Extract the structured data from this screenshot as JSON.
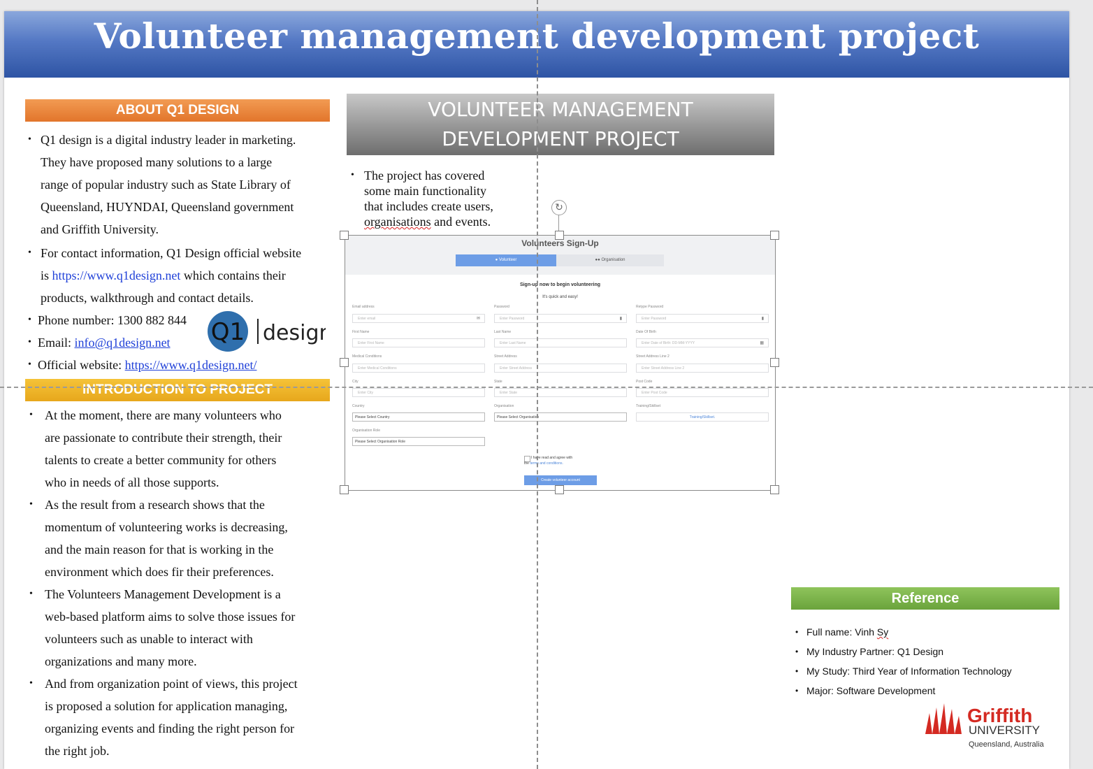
{
  "poster": {
    "title": "Volunteer management development project"
  },
  "about": {
    "heading": "ABOUT Q1 DESIGN",
    "p1_lines": [
      "Q1 design is a digital industry leader in marketing.",
      "They have proposed many solutions to a large",
      "range of popular industry such as State Library of",
      "Queensland, HUYNDAI, Queensland government",
      "and Griffith University."
    ],
    "p2_line1": "For contact information, Q1 Design official website",
    "p2_line2_pre": "is ",
    "p2_link": "https://www.q1design.net",
    "p2_line2_post": " which contains their",
    "p2_line3": "products, walkthrough and contact details.",
    "phone": "Phone number: 1300 882 844",
    "email_label": "Email: ",
    "email": "info@q1design.net",
    "website_label": "Official website: ",
    "website": "https://www.q1design.net/",
    "logo_q1": "Q1",
    "logo_design": "design"
  },
  "intro": {
    "heading": "INTRODUCTION TO PROJECT",
    "p1_lines": [
      "At the moment, there are many volunteers who",
      "are passionate to contribute their strength, their",
      "talents to create a better community for others",
      "who in needs of all those supports."
    ],
    "p2_lines": [
      "As the result from a research shows that the",
      "momentum of volunteering works is decreasing,",
      "and the main reason for that is working in the",
      "environment which does fir their preferences."
    ],
    "p3_lines": [
      "The Volunteers Management Development is a",
      "web-based platform aims to solve those issues for",
      "volunteers such as unable to interact with",
      "organizations and many more."
    ],
    "p4_lines": [
      "And from organization point of views, this project",
      "is proposed a solution for application managing,",
      "organizing events and finding the right person for",
      "the right job."
    ]
  },
  "project": {
    "heading_line1": "VOLUNTEER MANAGEMENT",
    "heading_line2": "DEVELOPMENT PROJECT",
    "lines": [
      "The project has covered",
      "some main functionality",
      "that includes create users,"
    ],
    "last_word": "organisations",
    "last_rest": " and events."
  },
  "signup": {
    "title": "Volunteers Sign-Up",
    "tab_volunteer": "Volunteer",
    "tab_organisation": "Organisation",
    "subtitle": "Sign-up now to begin volunteering",
    "tagline": "It's quick and easy!",
    "email_label": "Email address",
    "email_placeholder": "Enter email",
    "password_label": "Password",
    "password_placeholder": "Enter Password",
    "retype_label": "Retype Password",
    "retype_placeholder": "Enter Password",
    "first_label": "First Name",
    "first_placeholder": "Enter First Name",
    "last_label": "Last Name",
    "last_placeholder": "Enter Last Name",
    "dob_label": "Date Of Birth",
    "dob_placeholder": "Enter Date of Birth: DD-MM-YYYY",
    "medical_label": "Medical Conditions",
    "medical_placeholder": "Enter Medical Conditions",
    "street_label": "Street Address",
    "street_placeholder": "Enter Street Address",
    "street2_label": "Street Address Line 2",
    "street2_placeholder": "Enter Street Address Line 2",
    "city_label": "City",
    "city_placeholder": "Enter City",
    "state_label": "State",
    "state_placeholder": "Enter State",
    "postcode_label": "Post Code",
    "postcode_placeholder": "Enter Post Code",
    "country_label": "Country",
    "country_value": "Please Select Country",
    "org_label": "Organisation",
    "org_value": "Please Select Organisation",
    "training_label": "Training/Skillset",
    "training_value": "Training/Skillset.",
    "role_label": "Organisation Role",
    "role_value": "Please Select Organisation Role",
    "terms_line1": "I have read and agree with",
    "terms_pre": "the ",
    "terms_link": "terms and conditions.",
    "button": "Create volunteer account"
  },
  "reference": {
    "heading": "Reference",
    "name_pre": "Full name: Vinh ",
    "name_last": "Sy",
    "items": [
      "My Industry Partner: Q1 Design",
      "My Study: Third Year of Information Technology",
      "Major: Software Development"
    ],
    "uni_name": "Griffith",
    "uni_word": "UNIVERSITY",
    "uni_location": "Queensland, Australia"
  },
  "colors": {
    "title_band": "#2e54a4",
    "about_head": "#e2752b",
    "intro_head": "#e7a71c",
    "ref_head": "#6aa33c",
    "signup_accent": "#6d9de6",
    "griffith_red": "#d42a22"
  }
}
